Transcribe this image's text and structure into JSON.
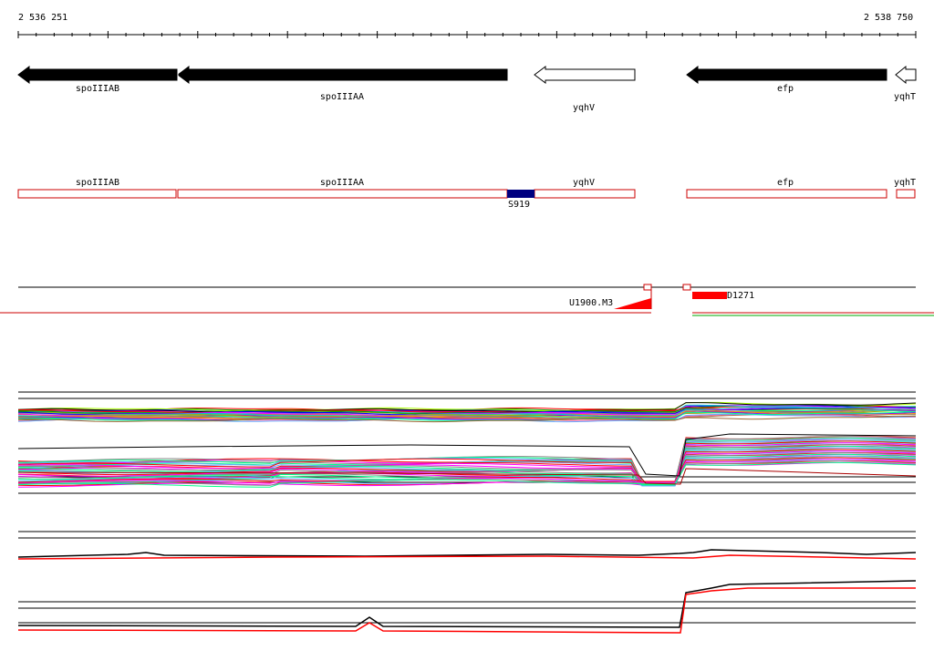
{
  "ruler": {
    "start_label": "2 536 251",
    "end_label": "2 538 750"
  },
  "genes": [
    {
      "name": "spoIIIAB",
      "strand": "minus",
      "filled": true
    },
    {
      "name": "spoIIIAA",
      "strand": "minus",
      "filled": true
    },
    {
      "name": "yqhV",
      "strand": "minus",
      "filled": false
    },
    {
      "name": "efp",
      "strand": "minus",
      "filled": true
    },
    {
      "name": "yqhT",
      "strand": "minus",
      "filled": false
    }
  ],
  "features": {
    "segment_label": "S919",
    "peak_left_label": "U1900.M3",
    "peak_right_label": "D1271"
  },
  "colors": {
    "gene_fill": "#000000",
    "gene_outline_track": "#cc0000",
    "segment": "#000080",
    "peak": "#ff0000",
    "expression_palette": [
      "#ff0000",
      "#00aa00",
      "#0000ff",
      "#ff00ff",
      "#00cccc",
      "#aaaa00",
      "#888888",
      "#ff8800",
      "#8800ff",
      "#00ff88",
      "#996633",
      "#ff66aa",
      "#66aaff",
      "#aaff00",
      "#000000"
    ]
  }
}
